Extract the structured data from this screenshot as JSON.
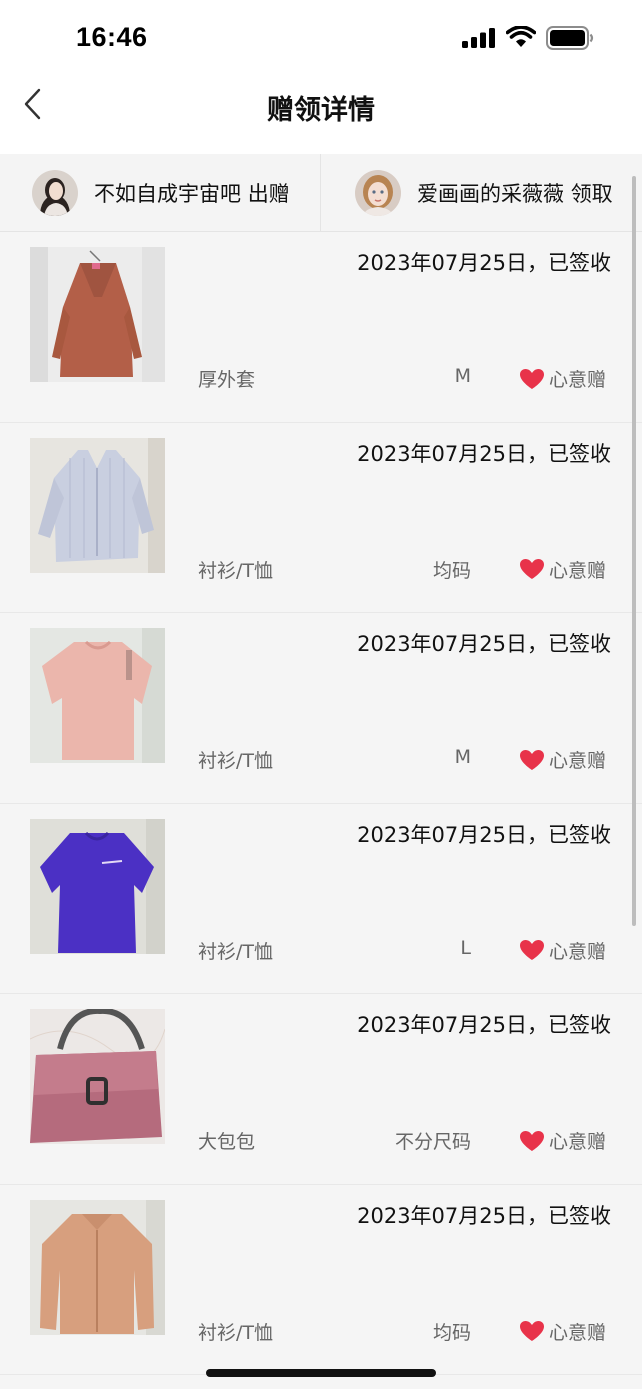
{
  "status_bar": {
    "time": "16:46"
  },
  "nav": {
    "title": "赠领详情"
  },
  "giver": {
    "name": "不如自成宇宙吧",
    "action": "出赠"
  },
  "receiver": {
    "name": "爱画画的采薇薇",
    "action": "领取"
  },
  "items": [
    {
      "date": "2023年07月25日，已签收",
      "category": "厚外套",
      "size": "M",
      "tag": "心意赠",
      "image": "coat"
    },
    {
      "date": "2023年07月25日，已签收",
      "category": "衬衫/T恤",
      "size": "均码",
      "tag": "心意赠",
      "image": "striped-shirt"
    },
    {
      "date": "2023年07月25日，已签收",
      "category": "衬衫/T恤",
      "size": "M",
      "tag": "心意赠",
      "image": "pink-tshirt"
    },
    {
      "date": "2023年07月25日，已签收",
      "category": "衬衫/T恤",
      "size": "L",
      "tag": "心意赠",
      "image": "purple-tshirt"
    },
    {
      "date": "2023年07月25日，已签收",
      "category": "大包包",
      "size": "不分尺码",
      "tag": "心意赠",
      "image": "handbag"
    },
    {
      "date": "2023年07月25日，已签收",
      "category": "衬衫/T恤",
      "size": "均码",
      "tag": "心意赠",
      "image": "tan-shirt"
    }
  ],
  "colors": {
    "heart": "#e8334a",
    "muted_text": "#666666",
    "background": "#f5f5f5"
  },
  "icons": [
    "back-chevron-icon",
    "signal-icon",
    "wifi-icon",
    "battery-icon",
    "heart-icon"
  ]
}
